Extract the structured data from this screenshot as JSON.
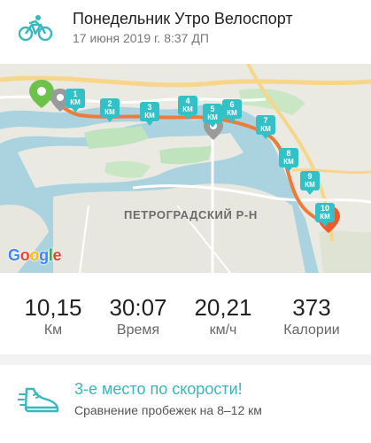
{
  "header": {
    "title": "Понедельник Утро Велоспорт",
    "subtitle": "17 июня 2019 г. 8:37 ДП",
    "activity_icon": "bicycle-icon"
  },
  "map": {
    "district_label": "ПЕТРОГРАДСКИЙ Р-Н",
    "attribution": [
      "G",
      "o",
      "o",
      "g",
      "l",
      "e"
    ],
    "unit": "КМ",
    "markers": [
      "1",
      "2",
      "3",
      "4",
      "5",
      "6",
      "7",
      "8",
      "9",
      "10"
    ],
    "route_color": "#ee7b3a",
    "start_pin_color": "#6cc24a",
    "end_pin_color": "#ee5a2c",
    "km_marker_color": "#33c1c8",
    "water_color": "#aad3df"
  },
  "stats": [
    {
      "value": "10,15",
      "label": "Км"
    },
    {
      "value": "30:07",
      "label": "Время"
    },
    {
      "value": "20,21",
      "label": "км/ч"
    },
    {
      "value": "373",
      "label": "Калории"
    }
  ],
  "achievement": {
    "icon": "running-shoe-icon",
    "rank_text": "3-е место по скорости!",
    "comparison_text": "Сравнение пробежек на 8–12 км",
    "accent_color": "#35b8be"
  }
}
